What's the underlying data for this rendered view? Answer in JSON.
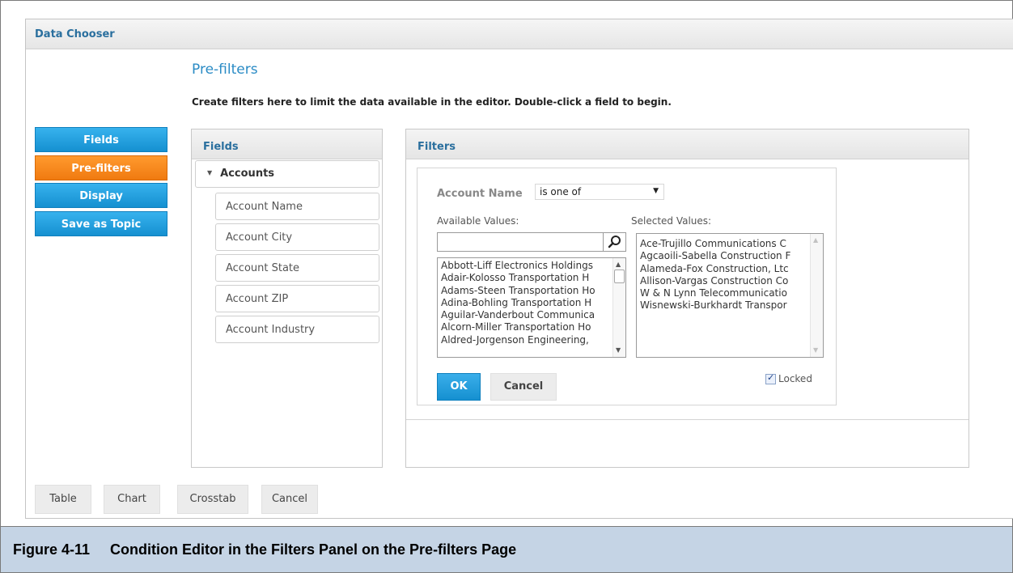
{
  "window": {
    "title": "Data Chooser"
  },
  "page": {
    "title": "Pre-filters",
    "description": "Create filters here to limit the data available in the editor. Double-click a field to begin."
  },
  "nav": [
    {
      "label": "Fields",
      "active": false
    },
    {
      "label": "Pre-filters",
      "active": true
    },
    {
      "label": "Display",
      "active": false
    },
    {
      "label": "Save as Topic",
      "active": false
    }
  ],
  "fields_panel": {
    "title": "Fields",
    "root": "Accounts",
    "items": [
      "Account Name",
      "Account City",
      "Account State",
      "Account ZIP",
      "Account Industry"
    ]
  },
  "filters_panel": {
    "title": "Filters",
    "field_label": "Account Name",
    "operator": "is one of",
    "available_label": "Available Values:",
    "selected_label": "Selected Values:",
    "search_value": "",
    "available_values": [
      "Abbott-Liff Electronics Holdings",
      "Adair-Kolosso Transportation H",
      "Adams-Steen Transportation Ho",
      "Adina-Bohling Transportation H",
      "Aguilar-Vanderbout Communica",
      "Alcorn-Miller Transportation Ho",
      "Aldred-Jorgenson Engineering,"
    ],
    "selected_values": [
      "Ace-Trujillo Communications C",
      "Agcaoili-Sabella Construction F",
      "Alameda-Fox Construction, Ltc",
      "Allison-Vargas Construction Co",
      "W & N Lynn Telecommunicatio",
      "Wisnewski-Burkhardt Transpor"
    ],
    "ok_label": "OK",
    "cancel_label": "Cancel",
    "locked_label": "Locked",
    "locked_checked": true
  },
  "bottom_buttons": [
    "Table",
    "Chart",
    "Crosstab",
    "Cancel"
  ],
  "caption": "Figure 4-11     Condition Editor in the Filters Panel on the Pre-filters Page",
  "icons": {
    "search": "search-icon",
    "checkbox": "checkmark-icon",
    "tree_toggle": "triangle-down-icon"
  },
  "colors": {
    "accent_blue": "#1c9ad8",
    "active_orange": "#f58a1f",
    "header_text": "#2a6f9e",
    "caption_bg": "#c5d4e5"
  }
}
